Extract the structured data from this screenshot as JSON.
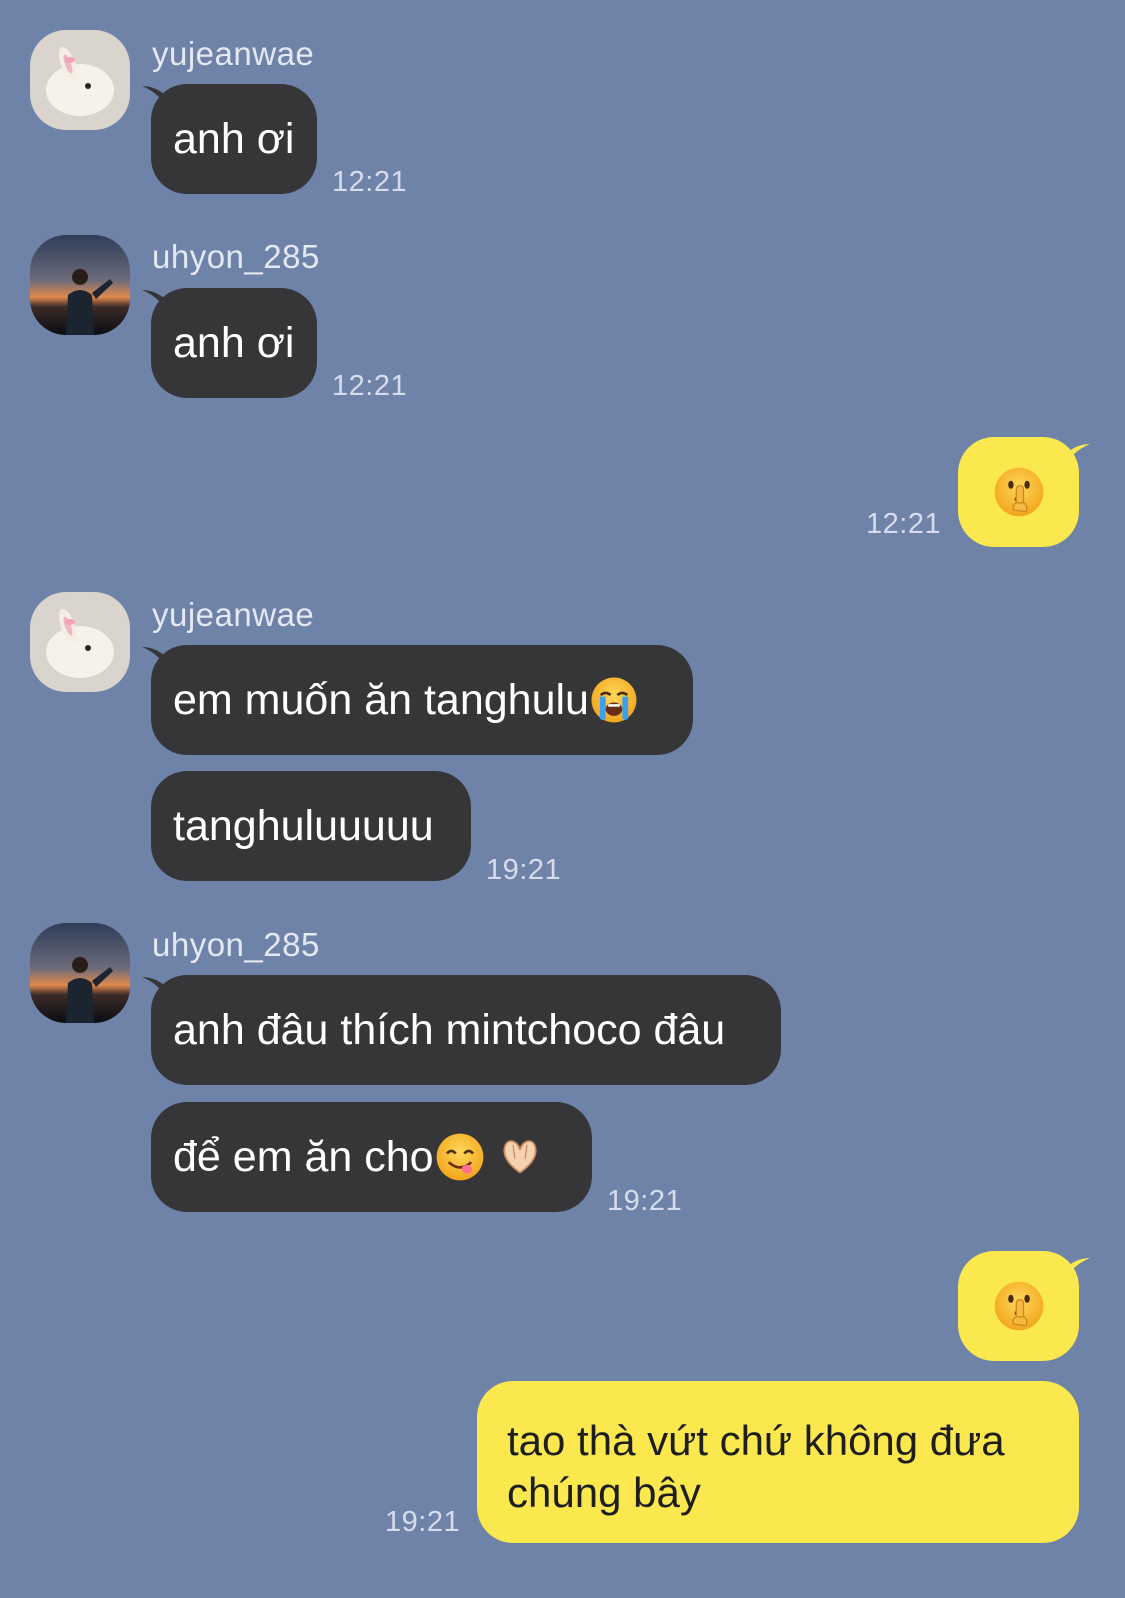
{
  "colors": {
    "background": "#6f83a8",
    "incoming_bubble": "#363639",
    "outgoing_bubble": "#fae84e"
  },
  "messages": [
    {
      "sender": "yujeanwae",
      "avatar": "bunny-avatar",
      "text": "anh ơi",
      "time": "12:21"
    },
    {
      "sender": "uhyon_285",
      "avatar": "sunset-portrait-avatar",
      "text": "anh ơi",
      "time": "12:21"
    },
    {
      "sender": "me",
      "emoji": "shushing-face-emoji",
      "time": "12:21"
    },
    {
      "sender": "yujeanwae",
      "avatar": "bunny-avatar",
      "text": "em muốn ăn tanghulu",
      "emoji": "loudly-crying-face-emoji"
    },
    {
      "sender": "yujeanwae",
      "text": "tanghuluuuuu",
      "time": "19:21"
    },
    {
      "sender": "uhyon_285",
      "avatar": "sunset-portrait-avatar",
      "text": "anh đâu thích mintchoco đâu"
    },
    {
      "sender": "uhyon_285",
      "text": "để em ăn cho",
      "emoji": [
        "yum-face-emoji",
        "heart-hands-emoji"
      ],
      "time": "19:21"
    },
    {
      "sender": "me",
      "emoji": "shushing-face-emoji"
    },
    {
      "sender": "me",
      "text_lines": [
        "tao thà vứt chứ không đưa",
        "chúng bây"
      ],
      "time": "19:21"
    }
  ]
}
